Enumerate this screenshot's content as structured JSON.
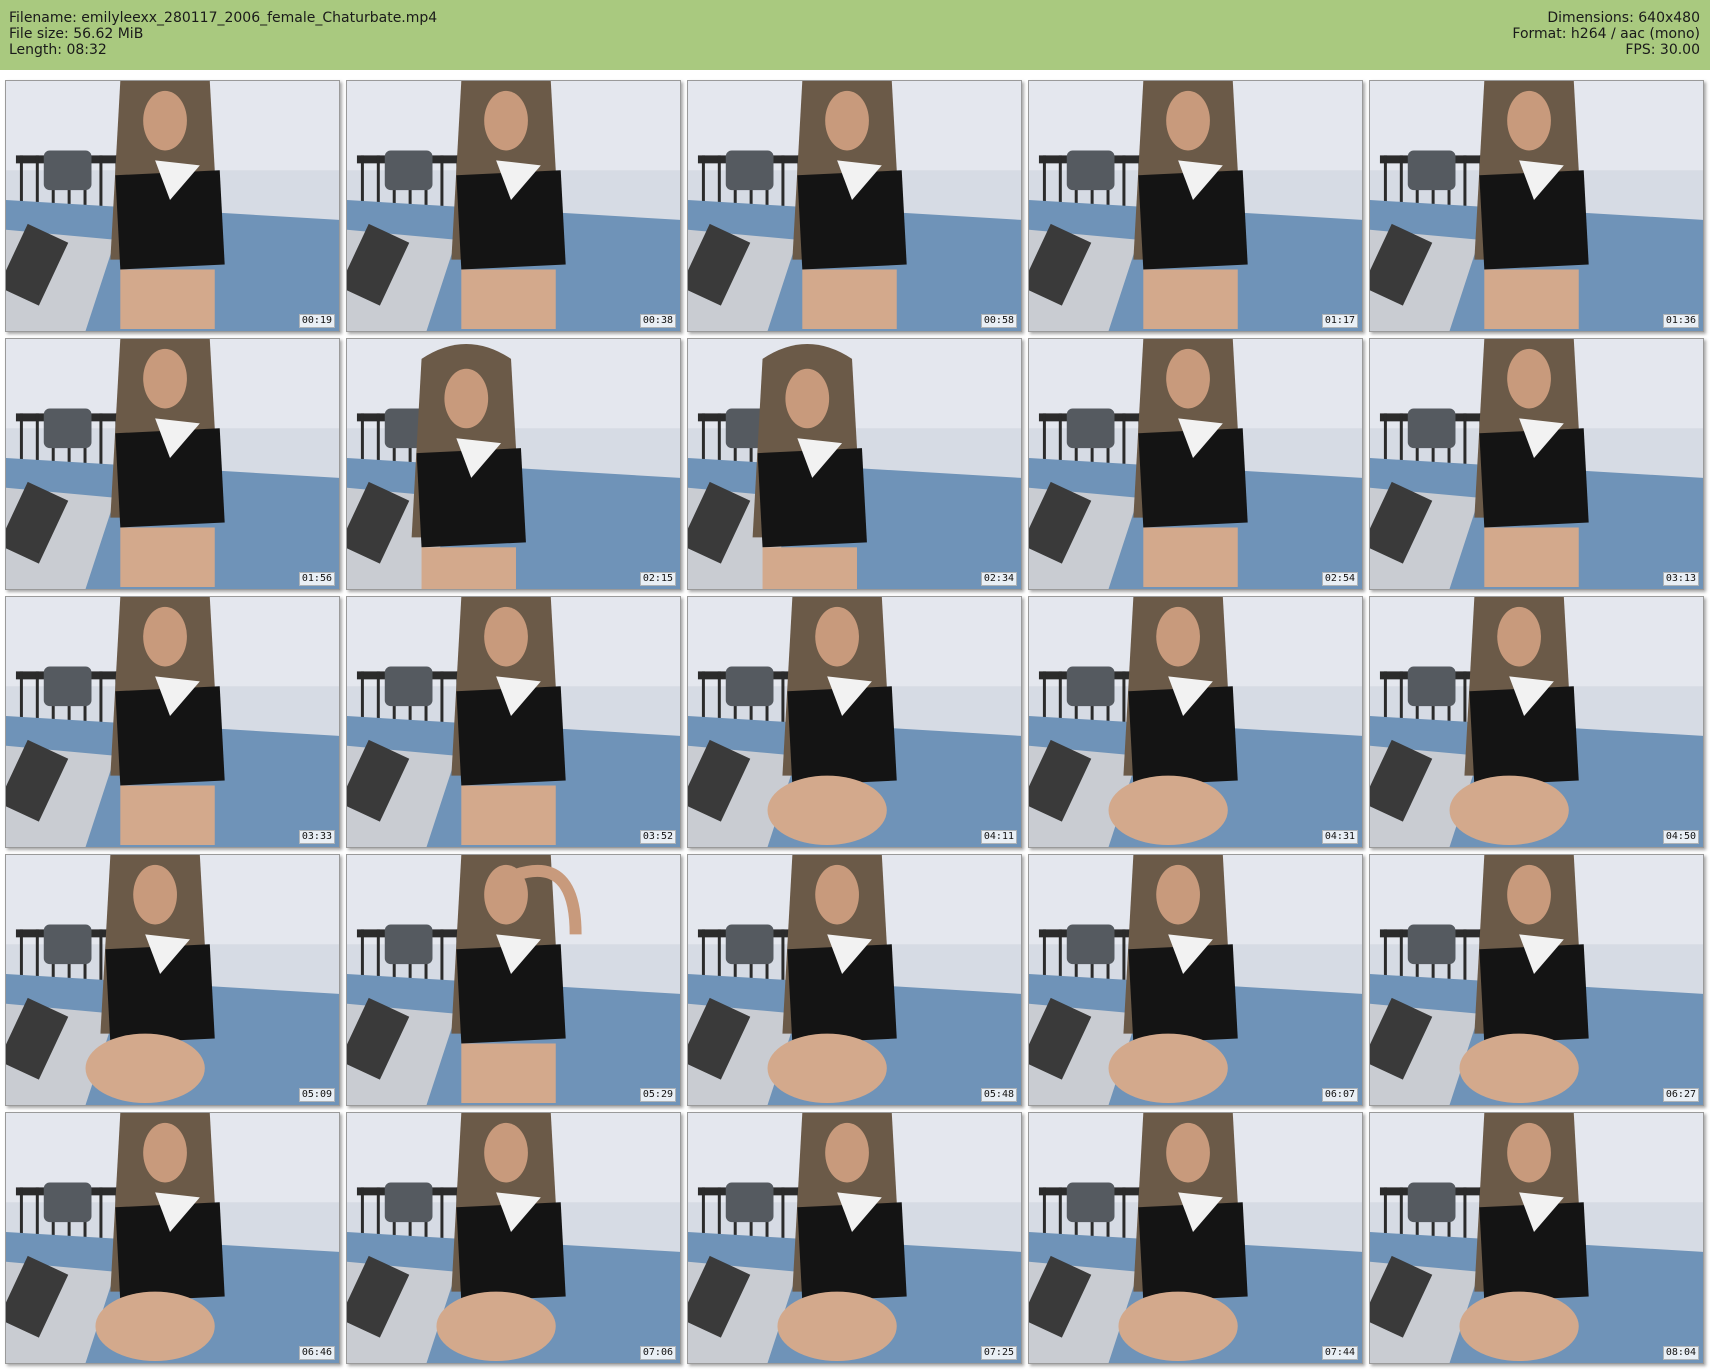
{
  "header": {
    "filename_line": "Filename: emilyleexx_280117_2006_female_Chaturbate.mp4",
    "filesize_line": "File size: 56.62 MiB",
    "length_line": "Length: 08:32",
    "dimensions_line": "Dimensions: 640x480",
    "format_line": "Format: h264 / aac (mono)",
    "fps_line": "FPS: 30.00"
  },
  "colors": {
    "header_bg": "#a9c97f",
    "page_bg": "#ffffff"
  },
  "thumbnails": [
    {
      "timestamp": "00:19"
    },
    {
      "timestamp": "00:38"
    },
    {
      "timestamp": "00:58"
    },
    {
      "timestamp": "01:17"
    },
    {
      "timestamp": "01:36"
    },
    {
      "timestamp": "01:56"
    },
    {
      "timestamp": "02:15"
    },
    {
      "timestamp": "02:34"
    },
    {
      "timestamp": "02:54"
    },
    {
      "timestamp": "03:13"
    },
    {
      "timestamp": "03:33"
    },
    {
      "timestamp": "03:52"
    },
    {
      "timestamp": "04:11"
    },
    {
      "timestamp": "04:31"
    },
    {
      "timestamp": "04:50"
    },
    {
      "timestamp": "05:09"
    },
    {
      "timestamp": "05:29"
    },
    {
      "timestamp": "05:48"
    },
    {
      "timestamp": "06:07"
    },
    {
      "timestamp": "06:27"
    },
    {
      "timestamp": "06:46"
    },
    {
      "timestamp": "07:06"
    },
    {
      "timestamp": "07:25"
    },
    {
      "timestamp": "07:44"
    },
    {
      "timestamp": "08:04"
    }
  ]
}
